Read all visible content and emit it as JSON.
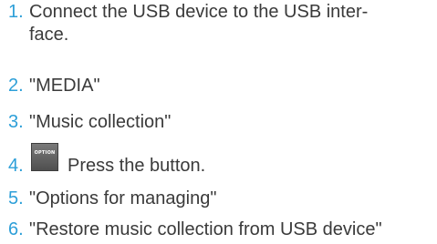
{
  "steps": [
    {
      "number": "1.",
      "text_line1": "Connect the USB device to the USB inter-",
      "text_line2": "face."
    },
    {
      "number": "2.",
      "text": "\"MEDIA\""
    },
    {
      "number": "3.",
      "text": "\"Music collection\""
    },
    {
      "number": "4.",
      "button_label": "OPTION",
      "text": "Press the button."
    },
    {
      "number": "5.",
      "text": "\"Options for managing\""
    },
    {
      "number": "6.",
      "text": "\"Restore music collection from USB device\""
    }
  ],
  "colors": {
    "number": "#2d9fd8",
    "text": "#3a3a3a",
    "button_bg": "#5f5f5f",
    "button_text": "#ffffff"
  }
}
